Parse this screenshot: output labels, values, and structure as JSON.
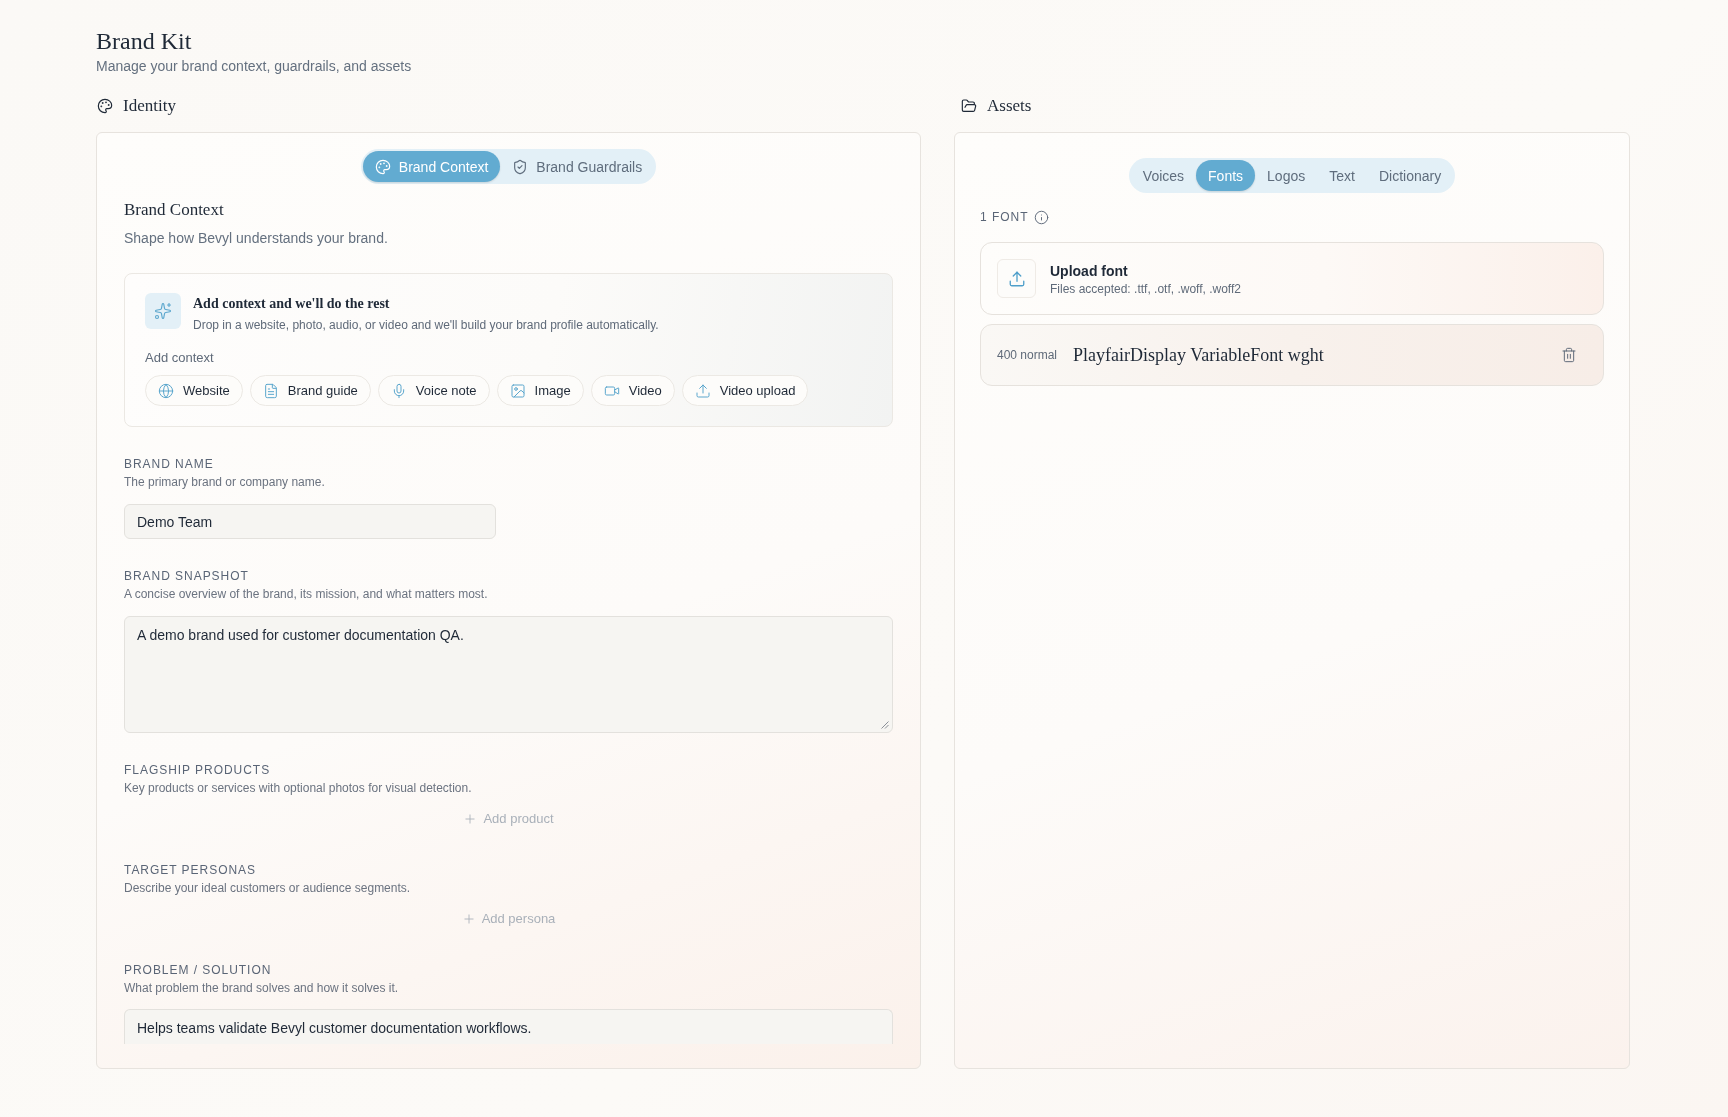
{
  "header": {
    "title": "Brand Kit",
    "subtitle": "Manage your brand context, guardrails, and assets"
  },
  "identity": {
    "heading": "Identity",
    "tabs": [
      {
        "label": "Brand Context",
        "selected": true
      },
      {
        "label": "Brand Guardrails",
        "selected": false
      }
    ],
    "section_title": "Brand Context",
    "section_subtitle": "Shape how Bevyl understands your brand.",
    "context_card": {
      "title": "Add context and we'll do the rest",
      "description": "Drop in a website, photo, audio, or video and we'll build your brand profile automatically.",
      "label": "Add context",
      "chips": [
        "Website",
        "Brand guide",
        "Voice note",
        "Image",
        "Video",
        "Video upload"
      ]
    },
    "fields": [
      {
        "kind": "input",
        "label": "BRAND NAME",
        "description": "The primary brand or company name.",
        "value": "Demo Team"
      },
      {
        "kind": "textarea",
        "label": "BRAND SNAPSHOT",
        "description": "A concise overview of the brand, its mission, and what matters most.",
        "value": "A demo brand used for customer documentation QA."
      },
      {
        "kind": "list",
        "label": "FLAGSHIP PRODUCTS",
        "description": "Key products or services with optional photos for visual detection.",
        "action": "Add product"
      },
      {
        "kind": "list",
        "label": "TARGET PERSONAS",
        "description": "Describe your ideal customers or audience segments.",
        "action": "Add persona"
      },
      {
        "kind": "textarea",
        "label": "PROBLEM / SOLUTION",
        "description": "What problem the brand solves and how it solves it.",
        "value": "Helps teams validate Bevyl customer documentation workflows."
      }
    ]
  },
  "assets": {
    "heading": "Assets",
    "tabs": [
      {
        "label": "Voices",
        "selected": false
      },
      {
        "label": "Fonts",
        "selected": true
      },
      {
        "label": "Logos",
        "selected": false
      },
      {
        "label": "Text",
        "selected": false
      },
      {
        "label": "Dictionary",
        "selected": false
      }
    ],
    "count": "1 FONT",
    "upload": {
      "title": "Upload font",
      "description": "Files accepted: .ttf, .otf, .woff, .woff2"
    },
    "fonts": [
      {
        "style": "400 normal",
        "name": "PlayfairDisplay VariableFont wght"
      }
    ]
  }
}
